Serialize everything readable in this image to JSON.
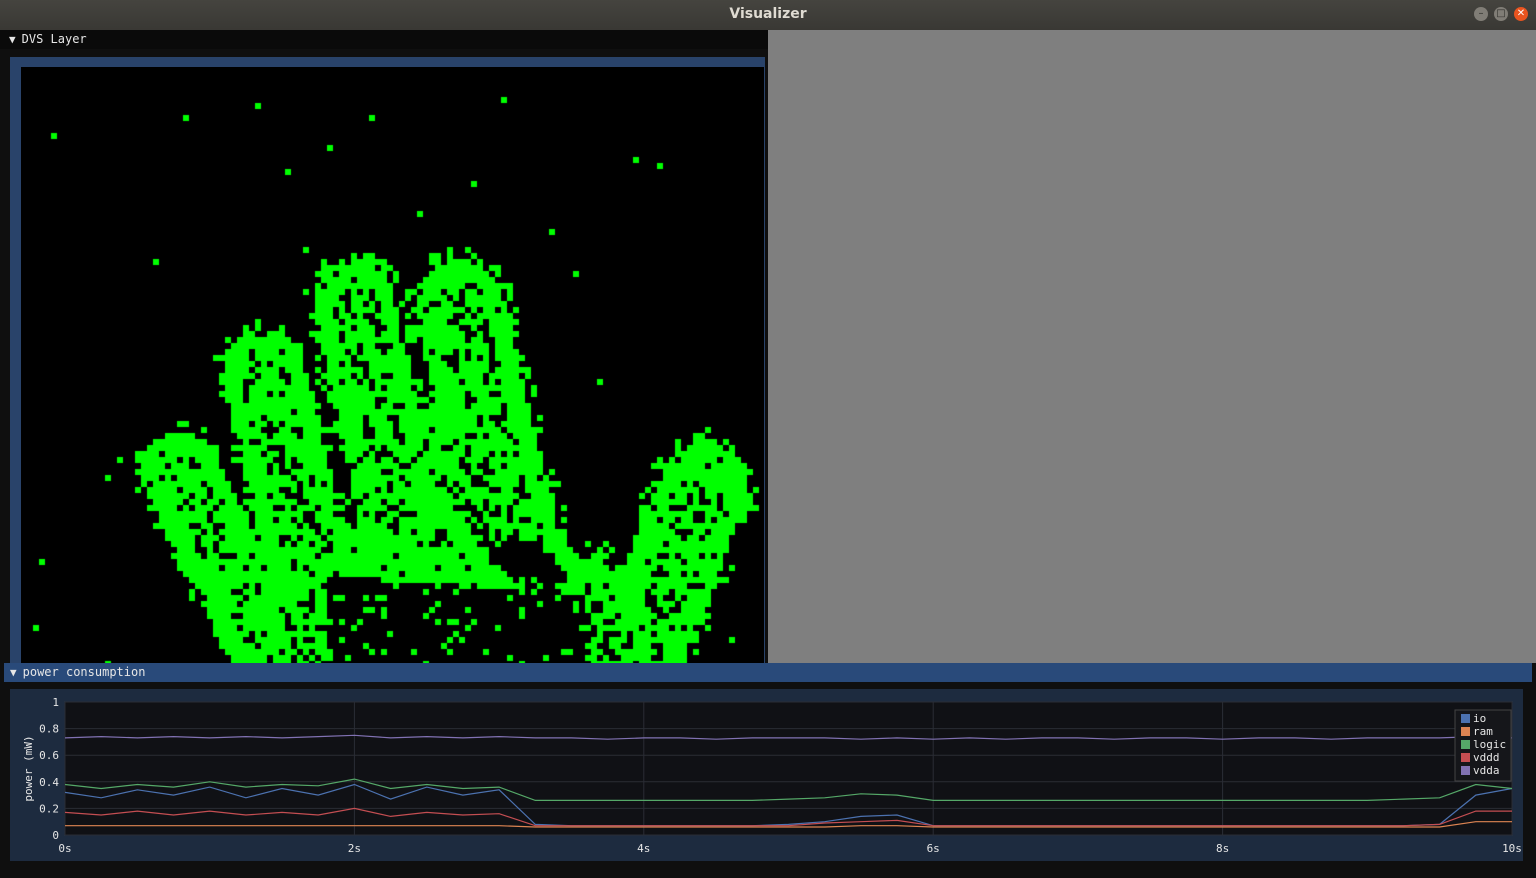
{
  "window": {
    "title": "Visualizer"
  },
  "dvs_panel": {
    "header": "DVS Layer"
  },
  "power_panel": {
    "header": "power consumption"
  },
  "colors": {
    "event": "#00ff00",
    "io": "#4c72b0",
    "ram": "#dd8452",
    "logic": "#55a868",
    "vddd": "#c44e52",
    "vdda": "#8172b3"
  },
  "chart_data": {
    "type": "line",
    "title": "",
    "xlabel": "",
    "ylabel": "power (mW)",
    "xlim": [
      0,
      10
    ],
    "ylim": [
      0,
      1
    ],
    "x_ticks": [
      "0s",
      "2s",
      "4s",
      "6s",
      "8s",
      "10s"
    ],
    "y_ticks": [
      "0",
      "0.2",
      "0.4",
      "0.6",
      "0.8",
      "1"
    ],
    "legend_position": "top-right",
    "x": [
      0,
      0.25,
      0.5,
      0.75,
      1,
      1.25,
      1.5,
      1.75,
      2,
      2.25,
      2.5,
      2.75,
      3,
      3.25,
      3.5,
      3.75,
      4,
      4.25,
      4.5,
      4.75,
      5,
      5.25,
      5.5,
      5.75,
      6,
      6.25,
      6.5,
      6.75,
      7,
      7.25,
      7.5,
      7.75,
      8,
      8.25,
      8.5,
      8.75,
      9,
      9.25,
      9.5,
      9.75,
      10
    ],
    "series": [
      {
        "name": "io",
        "values": [
          0.32,
          0.28,
          0.34,
          0.3,
          0.36,
          0.28,
          0.35,
          0.3,
          0.38,
          0.27,
          0.36,
          0.3,
          0.34,
          0.08,
          0.07,
          0.07,
          0.07,
          0.07,
          0.07,
          0.07,
          0.08,
          0.1,
          0.14,
          0.15,
          0.07,
          0.07,
          0.07,
          0.07,
          0.07,
          0.07,
          0.07,
          0.07,
          0.07,
          0.07,
          0.07,
          0.07,
          0.07,
          0.07,
          0.08,
          0.3,
          0.35
        ]
      },
      {
        "name": "ram",
        "values": [
          0.07,
          0.07,
          0.07,
          0.07,
          0.07,
          0.07,
          0.07,
          0.07,
          0.07,
          0.07,
          0.07,
          0.07,
          0.07,
          0.06,
          0.06,
          0.06,
          0.06,
          0.06,
          0.06,
          0.06,
          0.06,
          0.06,
          0.07,
          0.07,
          0.06,
          0.06,
          0.06,
          0.06,
          0.06,
          0.06,
          0.06,
          0.06,
          0.06,
          0.06,
          0.06,
          0.06,
          0.06,
          0.06,
          0.06,
          0.1,
          0.1
        ]
      },
      {
        "name": "logic",
        "values": [
          0.38,
          0.35,
          0.38,
          0.36,
          0.4,
          0.36,
          0.38,
          0.37,
          0.42,
          0.35,
          0.38,
          0.35,
          0.36,
          0.26,
          0.26,
          0.26,
          0.26,
          0.26,
          0.26,
          0.26,
          0.27,
          0.28,
          0.31,
          0.3,
          0.26,
          0.26,
          0.26,
          0.26,
          0.26,
          0.26,
          0.26,
          0.26,
          0.26,
          0.26,
          0.26,
          0.26,
          0.26,
          0.27,
          0.28,
          0.38,
          0.35
        ]
      },
      {
        "name": "vddd",
        "values": [
          0.17,
          0.15,
          0.18,
          0.15,
          0.18,
          0.15,
          0.17,
          0.15,
          0.2,
          0.14,
          0.17,
          0.15,
          0.16,
          0.07,
          0.07,
          0.07,
          0.07,
          0.07,
          0.07,
          0.07,
          0.07,
          0.09,
          0.1,
          0.11,
          0.07,
          0.07,
          0.07,
          0.07,
          0.07,
          0.07,
          0.07,
          0.07,
          0.07,
          0.07,
          0.07,
          0.07,
          0.07,
          0.07,
          0.08,
          0.18,
          0.18
        ]
      },
      {
        "name": "vdda",
        "values": [
          0.73,
          0.74,
          0.73,
          0.74,
          0.73,
          0.74,
          0.73,
          0.74,
          0.75,
          0.73,
          0.74,
          0.73,
          0.74,
          0.73,
          0.73,
          0.72,
          0.73,
          0.73,
          0.72,
          0.73,
          0.73,
          0.73,
          0.72,
          0.73,
          0.72,
          0.73,
          0.72,
          0.73,
          0.73,
          0.72,
          0.73,
          0.73,
          0.72,
          0.73,
          0.73,
          0.72,
          0.73,
          0.73,
          0.73,
          0.74,
          0.73
        ]
      }
    ]
  }
}
